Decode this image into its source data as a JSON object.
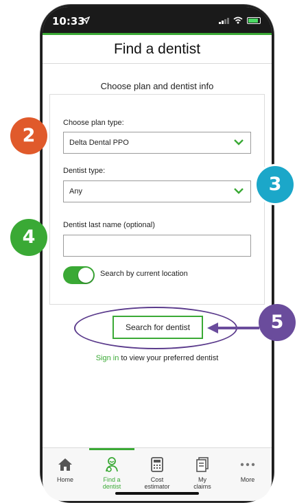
{
  "status": {
    "time": "10:33"
  },
  "header": {
    "title": "Find a dentist"
  },
  "form": {
    "subtitle": "Choose plan and dentist info",
    "plan_type_label": "Choose plan type:",
    "plan_type_value": "Delta Dental PPO",
    "dentist_type_label": "Dentist type:",
    "dentist_type_value": "Any",
    "last_name_label": "Dentist last name (optional)",
    "last_name_value": "",
    "location_toggle_label": "Search by current location",
    "location_toggle_on": true
  },
  "search_button": "Search for dentist",
  "signin": {
    "link": "Sign in",
    "text": " to view your preferred dentist"
  },
  "tabs": [
    {
      "label1": "Home",
      "label2": "",
      "icon": "home-icon"
    },
    {
      "label1": "Find a",
      "label2": "dentist",
      "icon": "dentist-search-icon",
      "active": true
    },
    {
      "label1": "Cost",
      "label2": "estimator",
      "icon": "calculator-icon"
    },
    {
      "label1": "My",
      "label2": "claims",
      "icon": "claims-icon"
    },
    {
      "label1": "More",
      "label2": "",
      "icon": "more-icon"
    }
  ],
  "callouts": [
    {
      "number": "2",
      "color": "#e05a2b"
    },
    {
      "number": "3",
      "color": "#1ba7c9"
    },
    {
      "number": "4",
      "color": "#3aa935"
    },
    {
      "number": "5",
      "color": "#6a4c9c"
    }
  ],
  "colors": {
    "accent": "#3aa935",
    "callout_outline": "#5b3b8c"
  }
}
